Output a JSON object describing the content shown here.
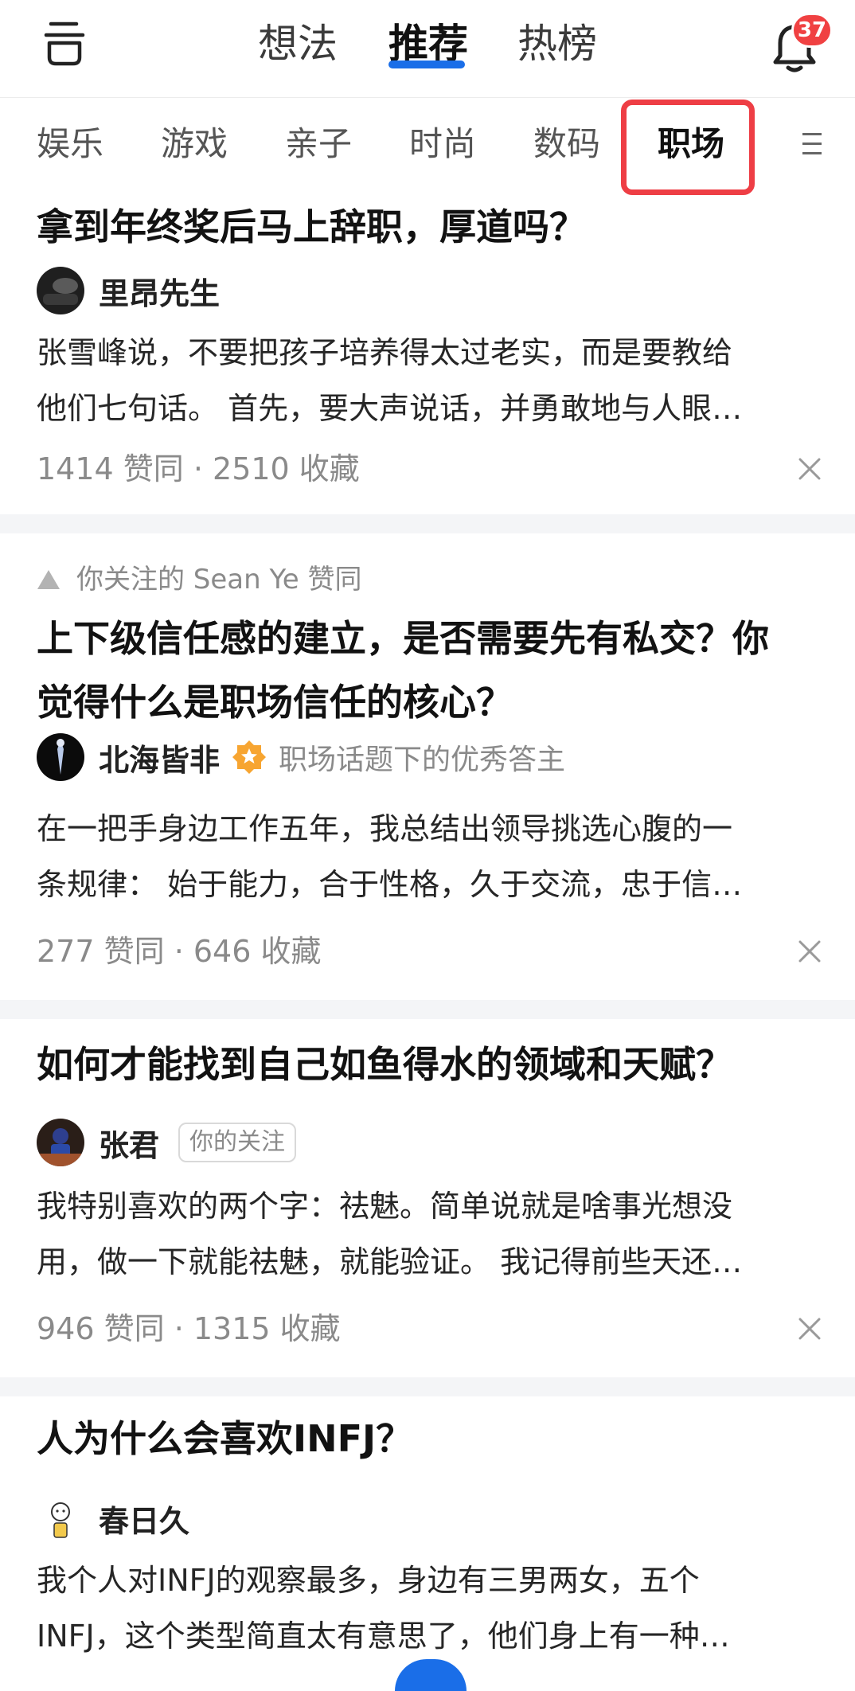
{
  "header": {
    "tabs": [
      "想法",
      "推荐",
      "热榜"
    ],
    "active_tab": "推荐",
    "notification_count": "37",
    "accent_color": "#1a6ee8",
    "badge_color": "#f04142",
    "icons": {
      "left": "cup-icon",
      "right": "bell-icon"
    }
  },
  "categories": {
    "items": [
      "娱乐",
      "游戏",
      "亲子",
      "时尚",
      "数码",
      "职场"
    ],
    "active": "职场",
    "highlight_color": "#ee3e45",
    "menu_icon": "menu-icon"
  },
  "feed": [
    {
      "title": "拿到年终奖后马上辞职，厚道吗？",
      "author": "里昂先生",
      "excerpt_lines": [
        "张雪峰说，不要把孩子培养得太过老实，而是要教给",
        "他们七句话。 首先，要大声说话，并勇敢地与人眼…"
      ],
      "meta": "1414 赞同 · 2510 收藏"
    },
    {
      "follow_note": "你关注的 Sean Ye 赞同",
      "title_lines": [
        "上下级信任感的建立，是否需要先有私交？你",
        "觉得什么是职场信任的核心？"
      ],
      "author": "北海皆非",
      "author_desc": "职场话题下的优秀答主",
      "excerpt_lines": [
        "在一把手身边工作五年，我总结出领导挑选心腹的一",
        "条规律： 始于能力，合于性格，久于交流，忠于信…"
      ],
      "meta": "277 赞同 · 646 收藏"
    },
    {
      "title": "如何才能找到自己如鱼得水的领域和天赋？",
      "author": "张君",
      "author_tag": "你的关注",
      "excerpt_lines": [
        "我特别喜欢的两个字：祛魅。简单说就是啥事光想没",
        "用，做一下就能祛魅，就能验证。 我记得前些天还…"
      ],
      "meta": "946 赞同 · 1315 收藏"
    },
    {
      "title": "人为什么会喜欢INFJ？",
      "author": "春日久",
      "excerpt_lines": [
        "我个人对INFJ的观察最多，身边有三男两女，五个",
        "INFJ，这个类型简直太有意思了，他们身上有一种…"
      ]
    }
  ]
}
